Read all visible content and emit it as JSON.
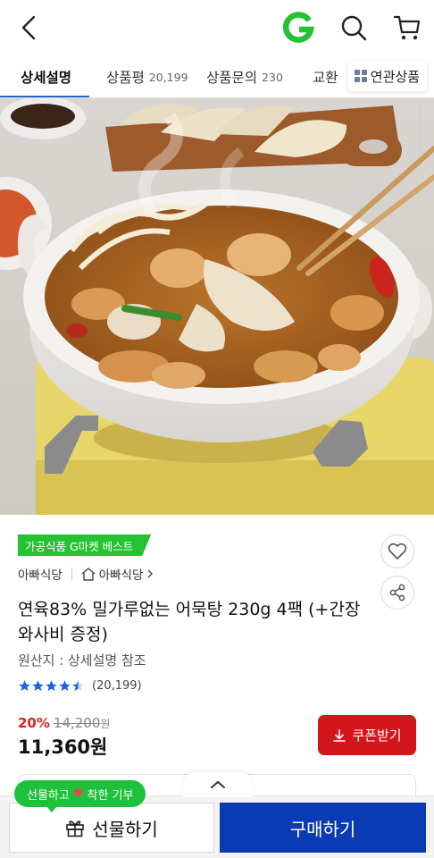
{
  "header": {
    "back_icon": "chevron-left-icon",
    "logo_letter": "G",
    "logo_color": "#25c232",
    "search_icon": "search-icon",
    "cart_icon": "cart-icon"
  },
  "tabs": {
    "items": [
      {
        "label": "상세설명",
        "count": ""
      },
      {
        "label": "상품평",
        "count": "20,199"
      },
      {
        "label": "상품문의",
        "count": "230"
      },
      {
        "label": "교환",
        "count": ""
      }
    ],
    "related_label": "연관상품",
    "active_color": "#2563c9"
  },
  "product": {
    "badge": "가공식품 G마켓 베스트",
    "seller": "아빠식당",
    "store": "아빠식당",
    "title": "연육83% 밀가루없는 어묵탕 230g 4팩 (+간장와사비 증정)",
    "origin": "원산지 : 상세설명 참조",
    "rating_count": "(20,199)",
    "rating_stars": 4.5,
    "discount": "20%",
    "original_price": "14,200",
    "original_price_unit": "원",
    "final_price": "11,360원",
    "coupon_label": "쿠폰받기",
    "coupon_color": "#d2161b"
  },
  "promo": {
    "gift_bubble_pre": "선물하고",
    "gift_bubble_heart": "♥",
    "gift_bubble_post": "착한 기부"
  },
  "bottom": {
    "gift_label": "선물하기",
    "buy_label": "구매하기",
    "buy_color": "#0a3bb5"
  }
}
